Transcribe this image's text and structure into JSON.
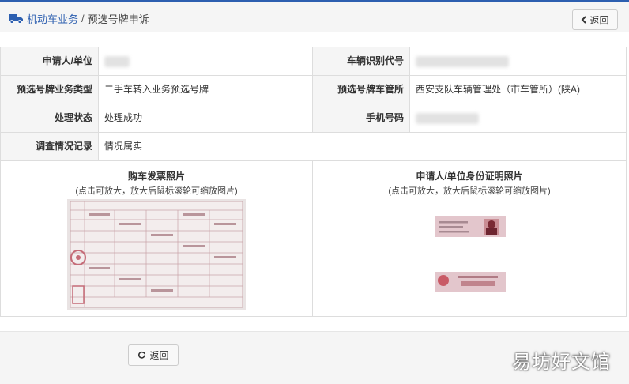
{
  "breadcrumb": {
    "root": "机动车业务",
    "separator": "/",
    "current": "预选号牌申诉"
  },
  "buttons": {
    "back_top": "返回",
    "back_bottom": "返回"
  },
  "info": {
    "applicant_label": "申请人/单位",
    "vin_label": "车辆识别代号",
    "business_type_label": "预选号牌业务类型",
    "business_type_value": "二手车转入业务预选号牌",
    "office_label": "预选号牌车管所",
    "office_value": "西安支队车辆管理处（市车管所）(陕A)",
    "status_label": "处理状态",
    "status_value": "处理成功",
    "phone_label": "手机号码",
    "investigation_label": "调查情况记录",
    "investigation_value": "情况属实"
  },
  "photos": {
    "invoice_title": "购车发票照片",
    "invoice_hint": "(点击可放大，放大后鼠标滚轮可缩放图片)",
    "id_title": "申请人/单位身份证明照片",
    "id_hint": "(点击可放大，放大后鼠标滚轮可缩放图片)"
  },
  "watermark": "易坊好文馆",
  "colors": {
    "accent": "#2d5fb0",
    "label_bg": "#f5f5f5",
    "border": "#dddddd"
  },
  "icons": {
    "breadcrumb": "truck-icon",
    "back_top": "chevron-left-icon",
    "back_bottom": "refresh-icon"
  }
}
